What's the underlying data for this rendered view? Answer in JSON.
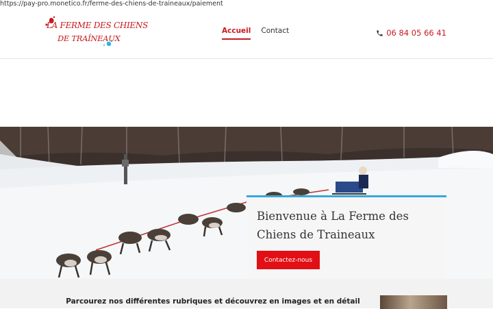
{
  "browser": {
    "url": "https://pay-pro.monetico.fr/ferme-des-chiens-de-traineaux/paiement"
  },
  "header": {
    "logo_line1": "LA FERME DES CHIENS",
    "logo_line2": "DE TRAÎNEAUX",
    "nav": [
      {
        "label": "Accueil",
        "active": true
      },
      {
        "label": "Contact",
        "active": false
      }
    ],
    "phone": "06 84 05 66 41",
    "phone_icon": "phone-icon"
  },
  "hero": {
    "title": "Bienvenue à La Ferme des Chiens de Traineaux",
    "cta_label": "Contactez-nous",
    "accent_color": "#37a8d8",
    "cta_color": "#e20f14"
  },
  "intro": {
    "text": "Parcourez nos différentes rubriques et découvrez en images et en détail"
  },
  "colors": {
    "brand": "#c8191e"
  }
}
